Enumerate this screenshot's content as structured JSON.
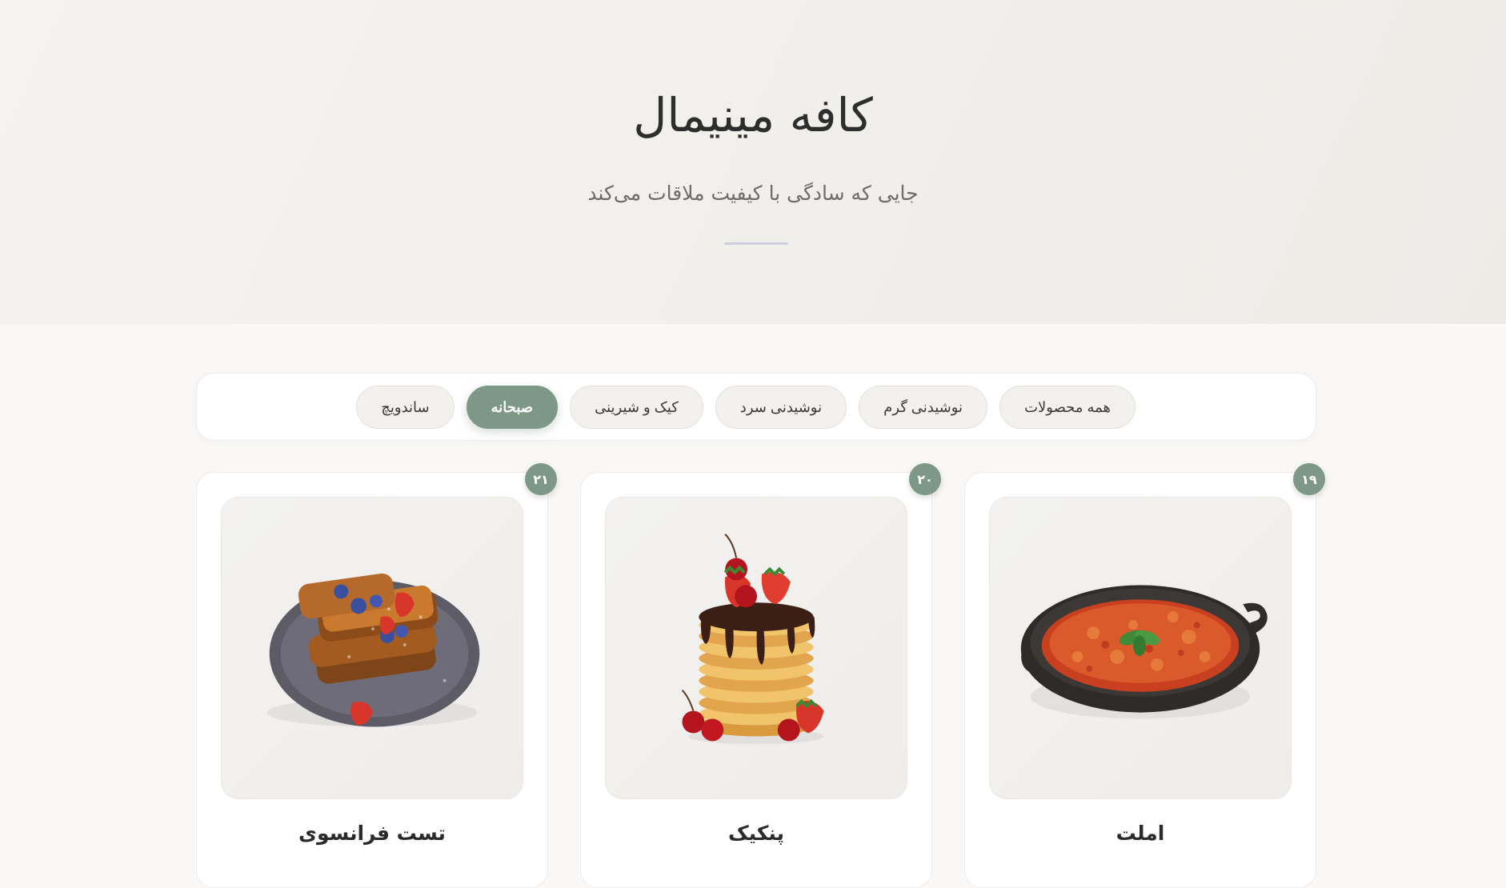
{
  "header": {
    "title": "کافه مینیمال",
    "subtitle": "جایی که سادگی با کیفیت ملاقات می‌کند"
  },
  "filters": [
    {
      "label": "همه محصولات",
      "active": false
    },
    {
      "label": "نوشیدنی گرم",
      "active": false
    },
    {
      "label": "نوشیدنی سرد",
      "active": false
    },
    {
      "label": "کیک و شیرینی",
      "active": false
    },
    {
      "label": "صبحانه",
      "active": true
    },
    {
      "label": "ساندویچ",
      "active": false
    }
  ],
  "products": [
    {
      "number": "۱۹",
      "name": "املت",
      "image_icon": "omelette-pan-icon",
      "description": ""
    },
    {
      "number": "۲۰",
      "name": "پنکیک",
      "image_icon": "pancake-stack-icon",
      "description": ""
    },
    {
      "number": "۲۱",
      "name": "تست فرانسوی",
      "image_icon": "french-toast-icon",
      "description": ""
    }
  ],
  "colors": {
    "accent": "#7d9886",
    "hero_bg": "#f2f0ed",
    "page_bg": "#f9f8f6",
    "divider": "#c9d0dc"
  }
}
